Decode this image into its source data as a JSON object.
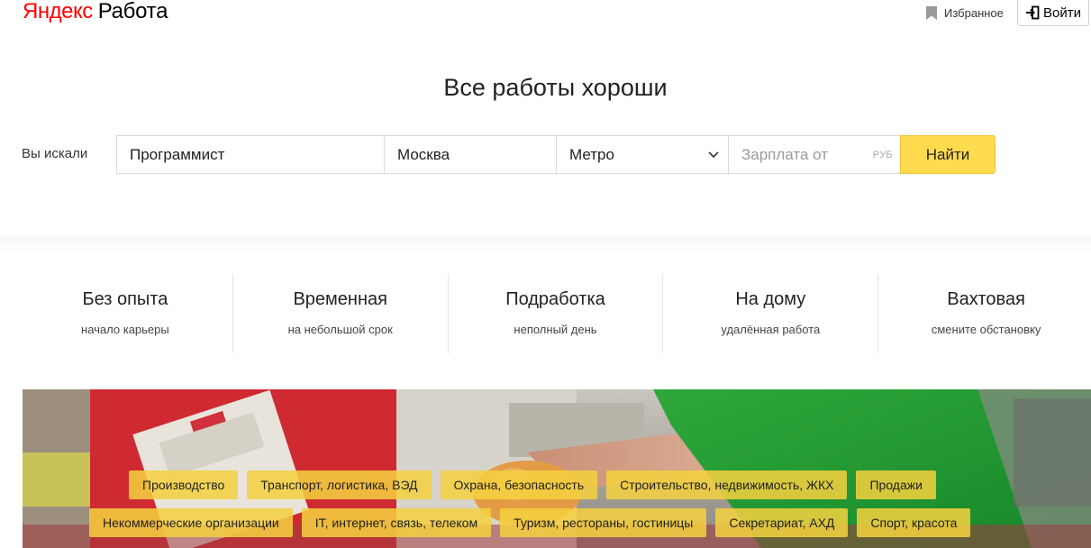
{
  "header": {
    "logo_yandex": "Яндекс",
    "logo_rabota": "Работа",
    "favorites_label": "Избранное",
    "login_label": "Войти"
  },
  "hero": {
    "title": "Все работы хороши"
  },
  "search": {
    "label": "Вы искали",
    "query_value": "Программист",
    "city_value": "Москва",
    "metro_value": "Метро",
    "salary_placeholder": "Зарплата от",
    "salary_unit": "РУБ",
    "find_label": "Найти"
  },
  "categories": [
    {
      "title": "Без опыта",
      "subtitle": "начало карьеры"
    },
    {
      "title": "Временная",
      "subtitle": "на небольшой срок"
    },
    {
      "title": "Подработка",
      "subtitle": "неполный день"
    },
    {
      "title": "На дому",
      "subtitle": "удалённая работа"
    },
    {
      "title": "Вахтовая",
      "subtitle": "смените обстановку"
    }
  ],
  "industry_tags": {
    "row1": [
      "Производство",
      "Транспорт, логистика, ВЭД",
      "Охрана, безопасность",
      "Строительство, недвижимость, ЖКХ",
      "Продажи"
    ],
    "row2": [
      "Некоммерческие организации",
      "IT, интернет, связь, телеком",
      "Туризм, рестораны, гостиницы",
      "Секретариат, АХД",
      "Спорт, красота"
    ]
  },
  "colors": {
    "logo_red": "#ff0000",
    "find_button": "#ffdb4d",
    "tag_background": "#f4d03f"
  }
}
